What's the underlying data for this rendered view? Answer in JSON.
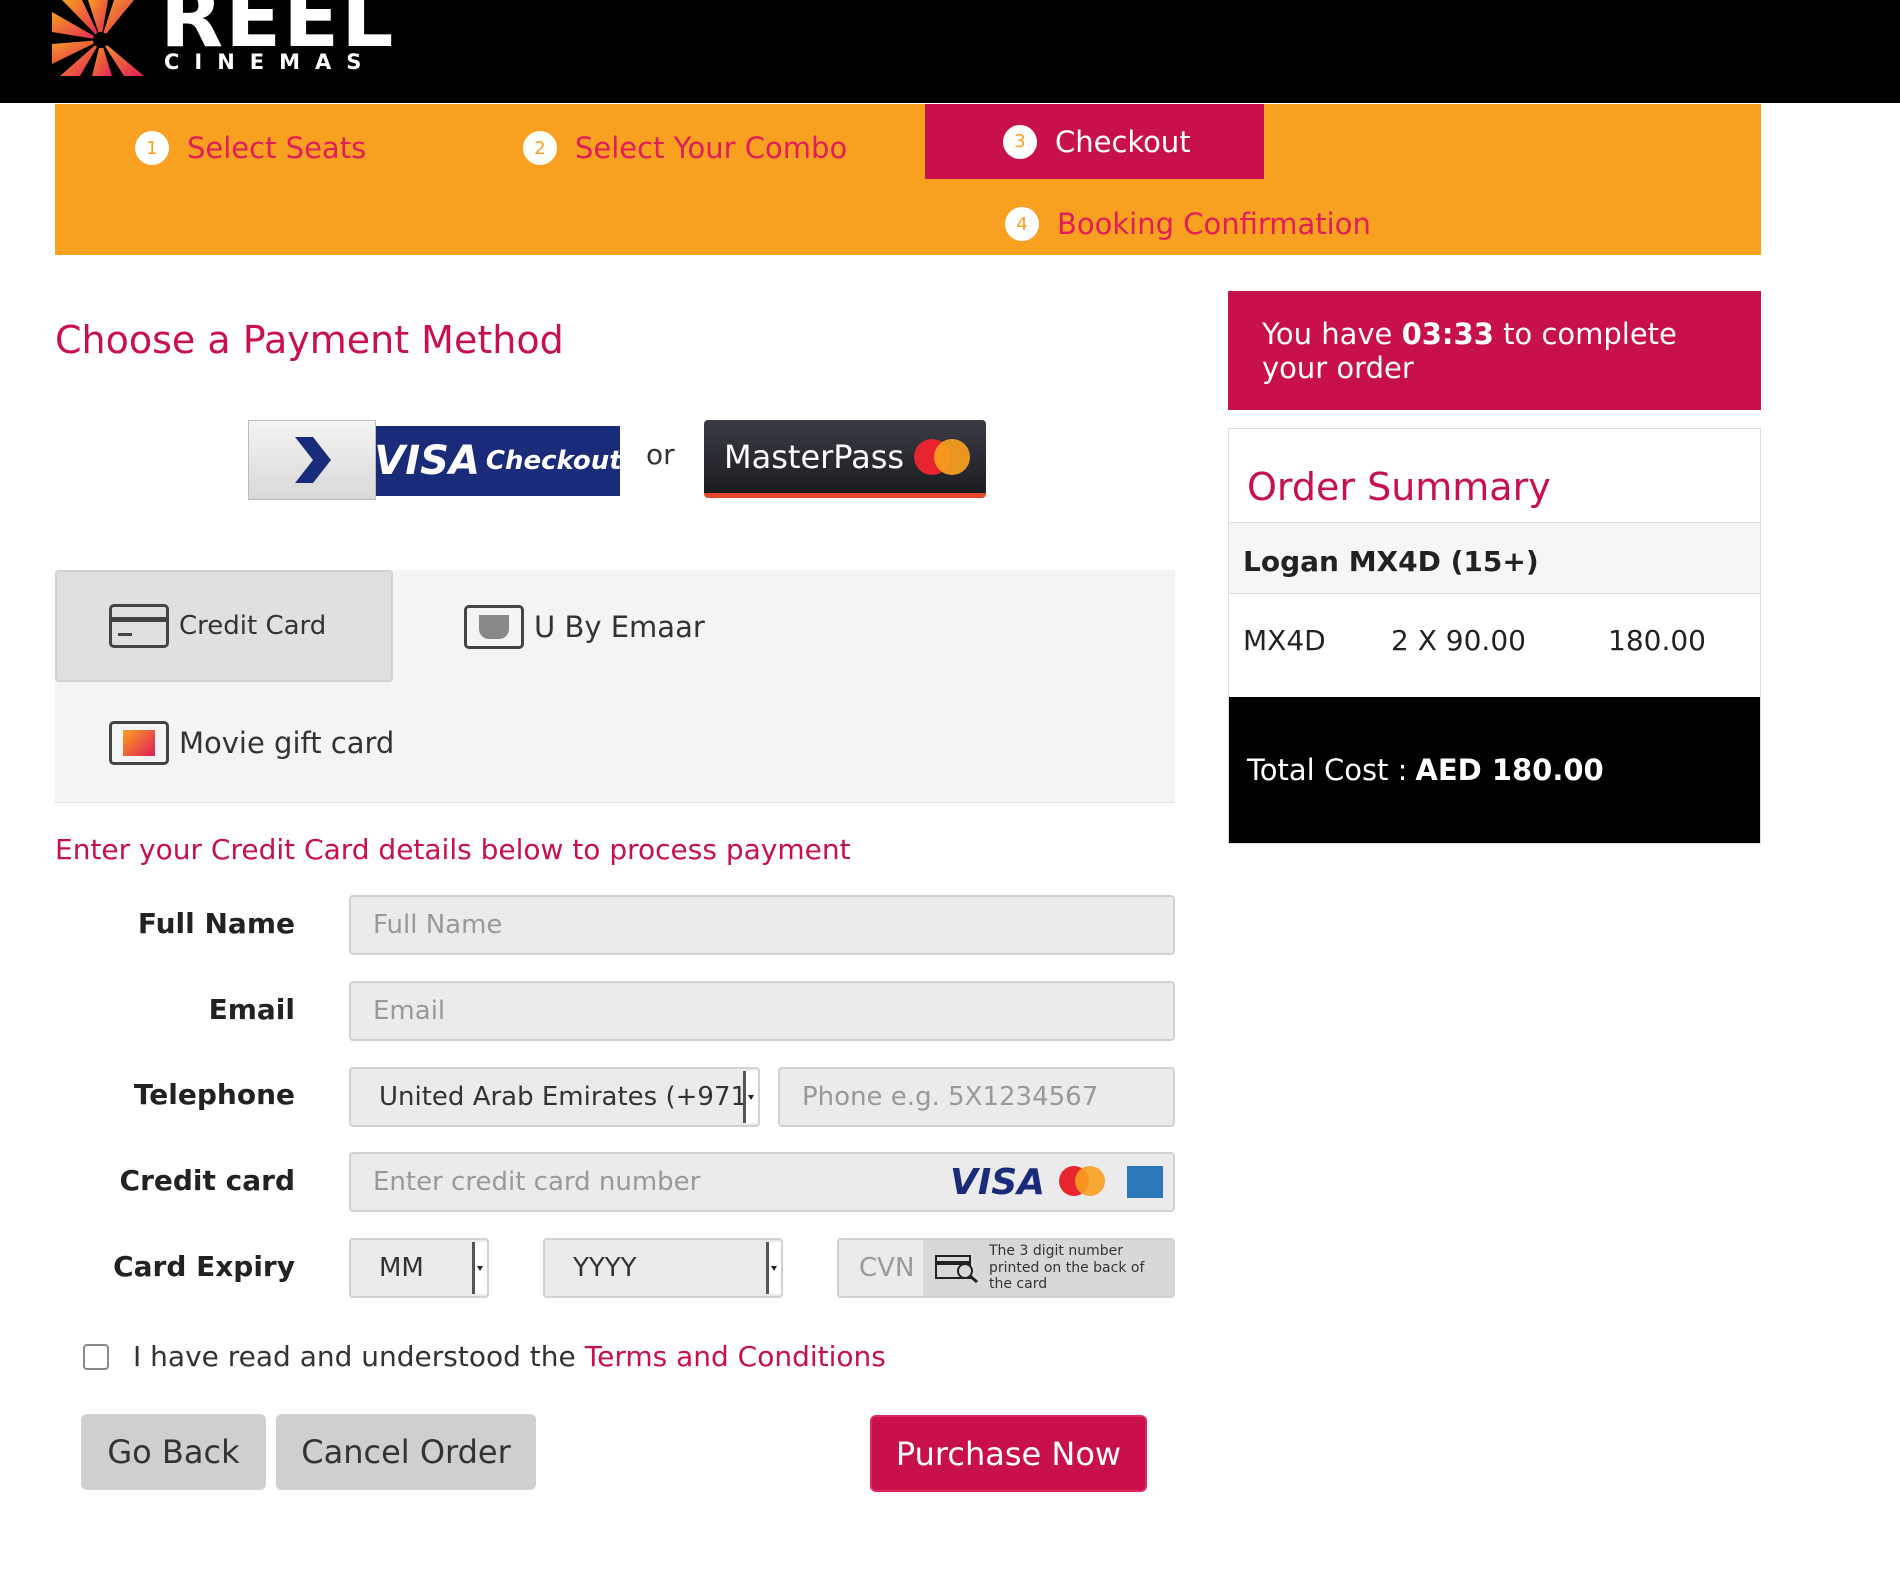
{
  "brand": {
    "name": "REEL",
    "sub": "CINEMAS"
  },
  "steps": [
    {
      "num": "1",
      "label": "Select Seats"
    },
    {
      "num": "2",
      "label": "Select Your Combo"
    },
    {
      "num": "3",
      "label": "Checkout"
    },
    {
      "num": "4",
      "label": "Booking Confirmation"
    }
  ],
  "payment": {
    "heading": "Choose a Payment Method",
    "visa_checkout": {
      "brand": "VISA",
      "word": "Checkout"
    },
    "or_label": "or",
    "masterpass": "MasterPass",
    "tabs": [
      {
        "label": "Credit Card",
        "icon": "credit-card-icon"
      },
      {
        "label": "U By Emaar",
        "icon": "u-by-emaar-icon"
      },
      {
        "label": "Movie gift card",
        "icon": "gift-card-icon"
      }
    ],
    "prompt": "Enter your Credit Card details below to process payment"
  },
  "form": {
    "full_name": {
      "label": "Full Name",
      "placeholder": "Full Name"
    },
    "email": {
      "label": "Email",
      "placeholder": "Email"
    },
    "telephone": {
      "label": "Telephone",
      "country": "United Arab Emirates (+971",
      "placeholder": "Phone e.g. 5X1234567"
    },
    "credit_card": {
      "label": "Credit card",
      "placeholder": "Enter credit card number",
      "brand_visa": "VISA"
    },
    "expiry": {
      "label": "Card Expiry",
      "month": "MM",
      "year": "YYYY",
      "cvn_placeholder": "CVN",
      "cvn_hint": "The 3 digit number printed on the back of the card"
    },
    "terms_text": "I have read and understood the",
    "terms_link": "Terms and Conditions"
  },
  "buttons": {
    "go_back": "Go Back",
    "cancel": "Cancel Order",
    "purchase": "Purchase Now"
  },
  "timer": {
    "prefix": "You have",
    "time": "03:33",
    "suffix": "to complete your order"
  },
  "order_summary": {
    "title": "Order Summary",
    "movie": "Logan MX4D (15+)",
    "line": {
      "type": "MX4D",
      "qty": "2 X 90.00",
      "amount": "180.00"
    },
    "total_label": "Total Cost :",
    "total_value": "AED 180.00"
  },
  "colors": {
    "brand_red": "#c8104a",
    "step_orange": "#f8a020",
    "black": "#000000"
  }
}
